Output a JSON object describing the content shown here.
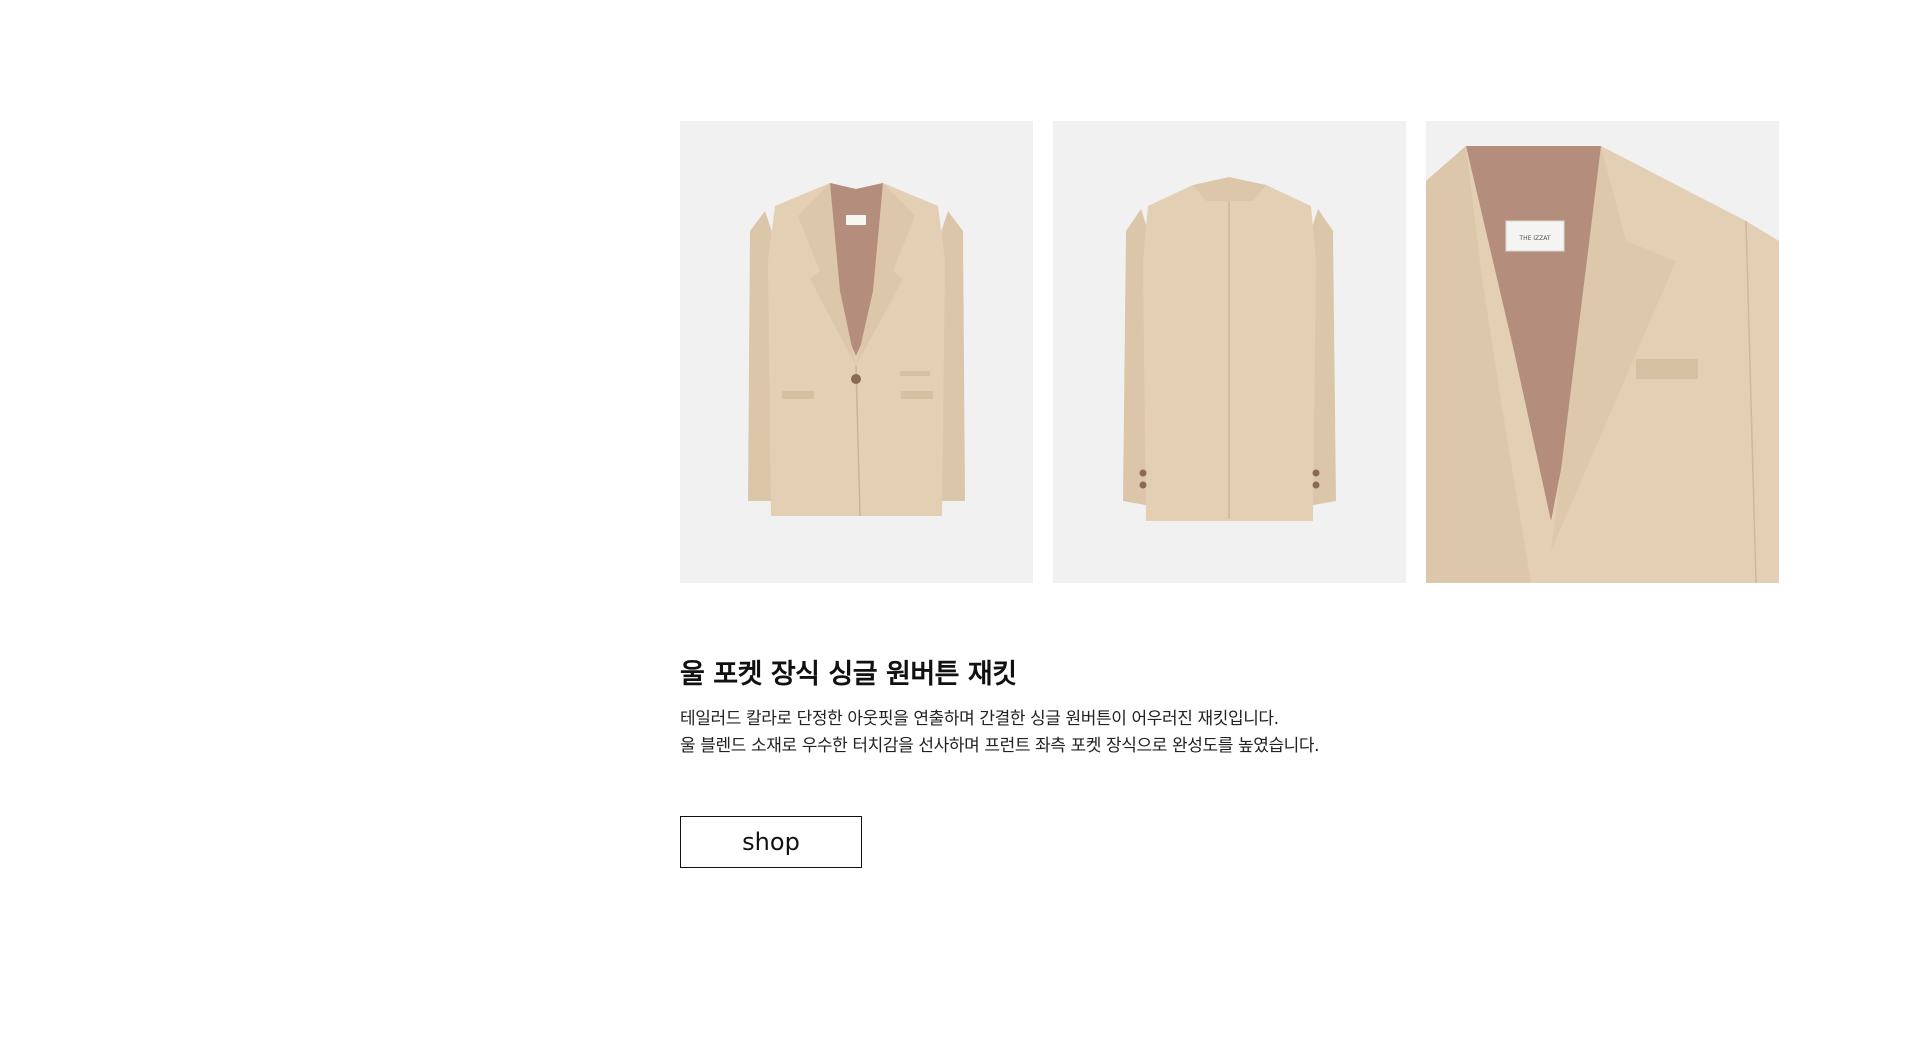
{
  "gallery": {
    "images": [
      {
        "alt": "jacket-front"
      },
      {
        "alt": "jacket-back"
      },
      {
        "alt": "jacket-detail"
      }
    ],
    "label_text": "THE IZZAT"
  },
  "product": {
    "title": "울 포켓 장식 싱글 원버튼 재킷",
    "description_lines": [
      "테일러드 칼라로 단정한 아웃핏을 연출하며 간결한 싱글 원버튼이 어우러진 재킷입니다.",
      "울 블렌드 소재로 우수한 터치감을 선사하며 프런트 좌측 포켓 장식으로 완성도를 높였습니다."
    ]
  },
  "actions": {
    "shop_label": "shop"
  },
  "colors": {
    "jacket": "#e3cfb4",
    "lining": "#b58d7c",
    "photo_bg": "#f1f1f1"
  }
}
